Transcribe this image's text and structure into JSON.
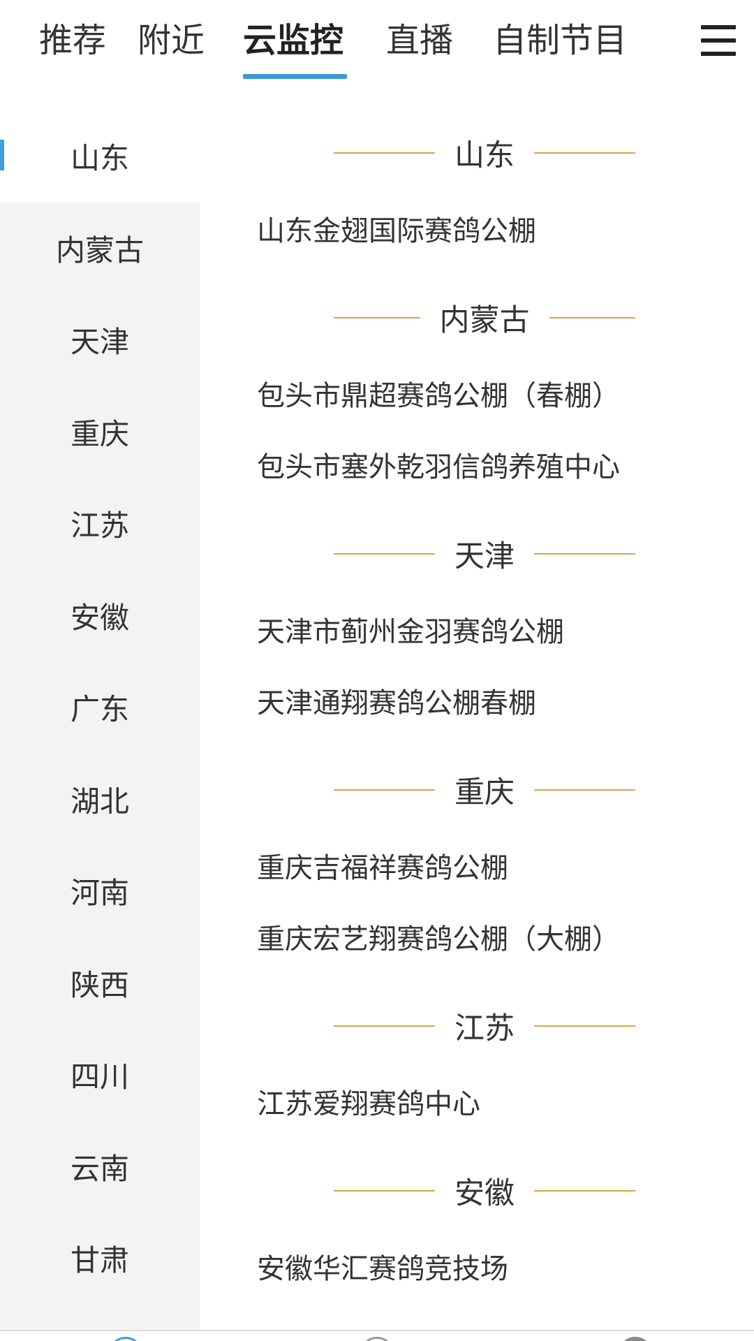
{
  "top_tabs": [
    {
      "label": "推荐",
      "active": false
    },
    {
      "label": "附近",
      "active": false
    },
    {
      "label": "云监控",
      "active": true
    },
    {
      "label": "直播",
      "active": false
    },
    {
      "label": "自制节目",
      "active": false
    }
  ],
  "menu_icon": "hamburger-menu-icon",
  "accent_color": "#3a9ad9",
  "divider_color": "#d9a441",
  "sidebar": {
    "active_index": 0,
    "items": [
      "山东",
      "内蒙古",
      "天津",
      "重庆",
      "江苏",
      "安徽",
      "广东",
      "湖北",
      "河南",
      "陕西",
      "四川",
      "云南",
      "甘肃"
    ]
  },
  "sections": [
    {
      "title": "山东",
      "venues": [
        "山东金翅国际赛鸽公棚"
      ]
    },
    {
      "title": "内蒙古",
      "venues": [
        "包头市鼎超赛鸽公棚（春棚）",
        "包头市塞外乾羽信鸽养殖中心"
      ]
    },
    {
      "title": "天津",
      "venues": [
        "天津市蓟州金羽赛鸽公棚",
        "天津通翔赛鸽公棚春棚"
      ]
    },
    {
      "title": "重庆",
      "venues": [
        "重庆吉福祥赛鸽公棚",
        "重庆宏艺翔赛鸽公棚（大棚）"
      ]
    },
    {
      "title": "江苏",
      "venues": [
        "江苏爱翔赛鸽中心"
      ]
    },
    {
      "title": "安徽",
      "venues": [
        "安徽华汇赛鸽竞技场"
      ]
    }
  ]
}
